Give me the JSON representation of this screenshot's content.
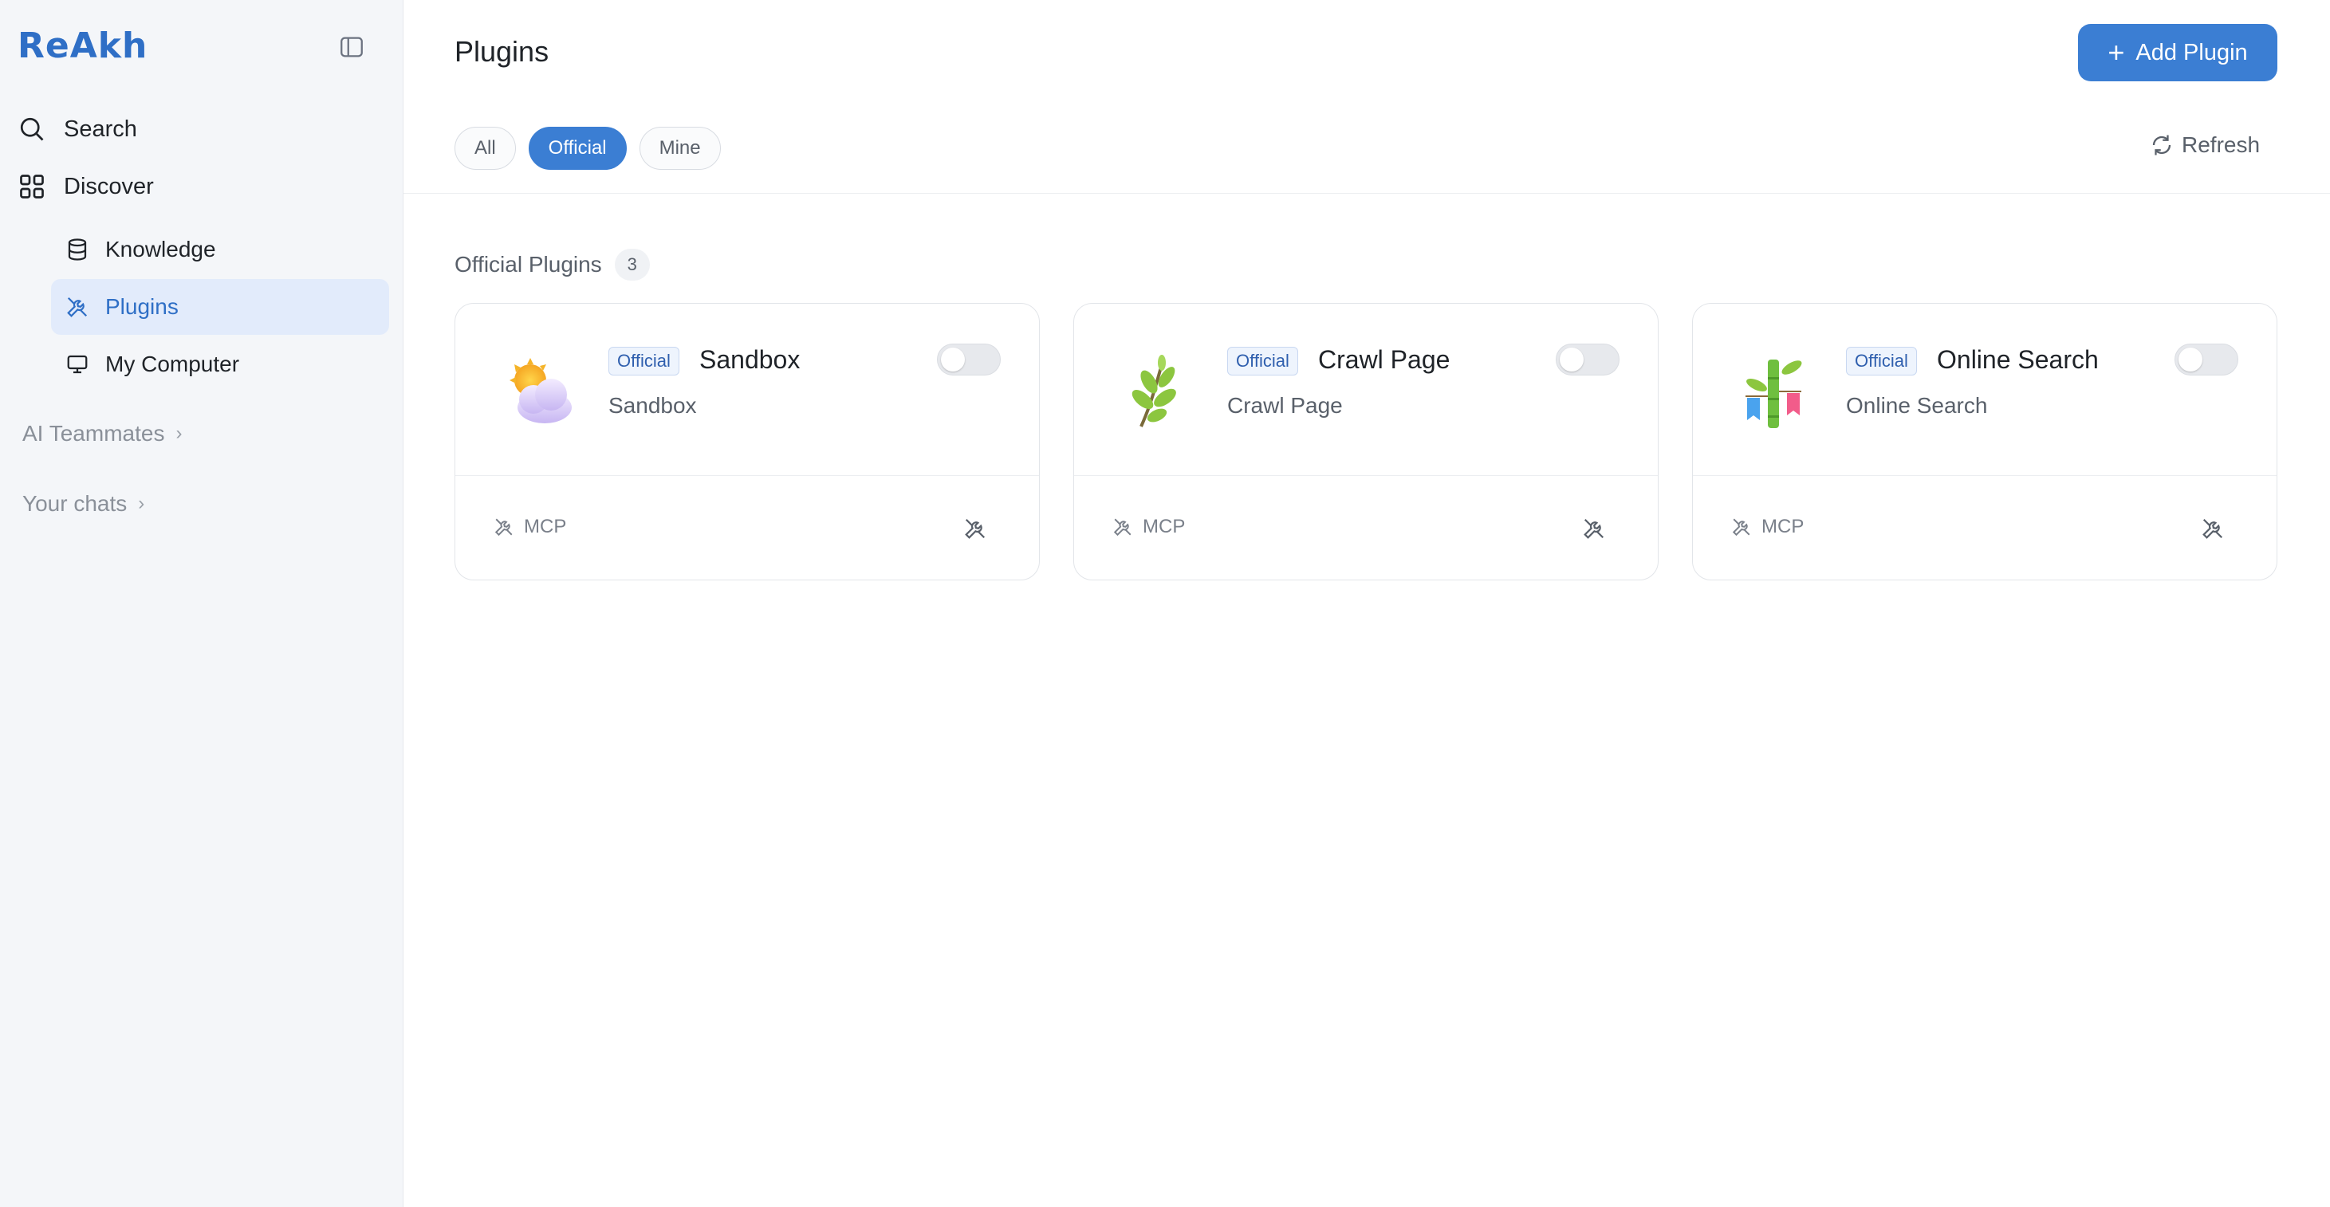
{
  "brand": {
    "logo_text": "ReAkh",
    "accent": "#3b7ed3"
  },
  "sidebar": {
    "collapse_icon": "sidebar-toggle-icon",
    "nav": [
      {
        "label": "Search",
        "icon": "search-icon"
      },
      {
        "label": "Discover",
        "icon": "grid-icon"
      }
    ],
    "sub_items": [
      {
        "label": "Knowledge",
        "icon": "database-icon",
        "active": false
      },
      {
        "label": "Plugins",
        "icon": "tools-icon",
        "active": true
      },
      {
        "label": "My Computer",
        "icon": "monitor-icon",
        "active": false
      }
    ],
    "sections": [
      {
        "label": "AI Teammates"
      },
      {
        "label": "Your chats"
      }
    ]
  },
  "main": {
    "title": "Plugins",
    "add_button": "Add Plugin",
    "filters": [
      {
        "label": "All",
        "active": false
      },
      {
        "label": "Official",
        "active": true
      },
      {
        "label": "Mine",
        "active": false
      }
    ],
    "refresh_label": "Refresh",
    "section": {
      "title": "Official Plugins",
      "count": "3"
    },
    "plugins": [
      {
        "tag": "Official",
        "name": "Sandbox",
        "description": "Sandbox",
        "type": "MCP",
        "enabled": false,
        "image": "cloud-sun-image"
      },
      {
        "tag": "Official",
        "name": "Crawl Page",
        "description": "Crawl Page",
        "type": "MCP",
        "enabled": false,
        "image": "leaf-branch-image"
      },
      {
        "tag": "Official",
        "name": "Online Search",
        "description": "Online Search",
        "type": "MCP",
        "enabled": false,
        "image": "bamboo-flags-image"
      }
    ]
  }
}
